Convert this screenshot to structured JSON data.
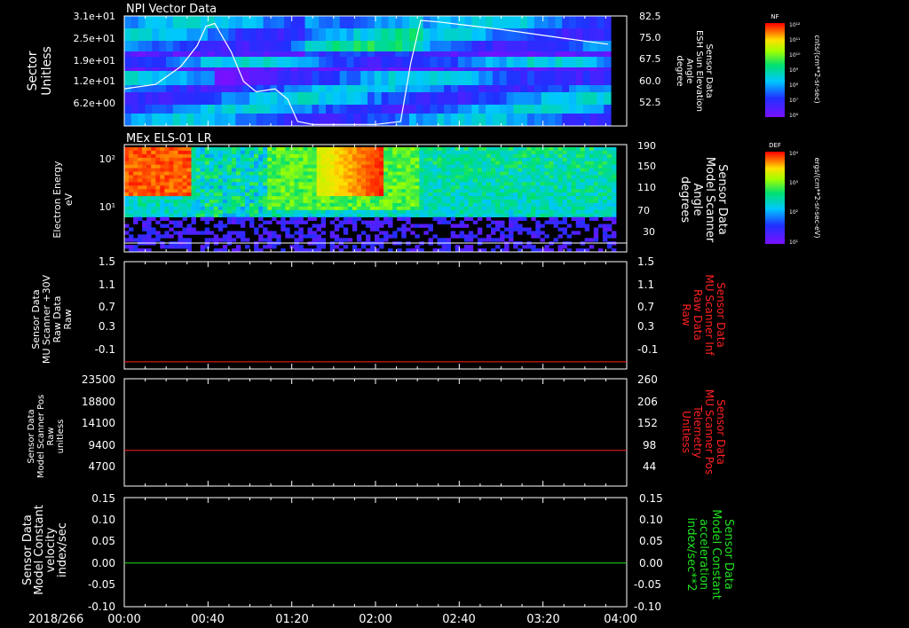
{
  "date_label": "2018/266",
  "x_ticks": [
    "00:00",
    "00:40",
    "01:20",
    "02:00",
    "02:40",
    "03:20",
    "04:00"
  ],
  "panels": [
    {
      "title": "NPI Vector Data",
      "left_label": [
        "Sector",
        "Unitless"
      ],
      "left_ticks": [
        "3.1e+01",
        "2.5e+01",
        "1.9e+01",
        "1.2e+01",
        "6.2e+00"
      ],
      "right_label": [
        "Sensor Data",
        "ESH Sun Elevation",
        "Angle",
        "degree"
      ],
      "right_ticks": [
        "82.5",
        "75.0",
        "67.5",
        "60.0",
        "52.5"
      ],
      "right_label_color": "#ffffff",
      "colorbar": {
        "label": "NF",
        "unit": "cnts/(cm**2-sr-sec)",
        "ticks": [
          "10¹²",
          "10¹¹",
          "10¹⁰",
          "10⁹",
          "10⁸",
          "10⁷",
          "10⁶"
        ]
      }
    },
    {
      "title": "MEx ELS-01 LR",
      "left_label": [
        "Electron Energy",
        "eV"
      ],
      "left_ticks": [
        "10²",
        "10¹"
      ],
      "right_label": [
        "Sensor Data",
        "Model Scanner",
        "Angle",
        "degrees"
      ],
      "right_ticks": [
        "190",
        "150",
        "110",
        "70",
        "30"
      ],
      "right_label_color": "#ffffff",
      "colorbar": {
        "label": "DEF",
        "unit": "ergs/(cm**2-sr-sec-eV)",
        "ticks": [
          "10⁴",
          "10³",
          "10²",
          "10¹"
        ]
      }
    },
    {
      "title": "",
      "left_label": [
        "Sensor Data",
        "MU Scanner +30V",
        "Raw Data",
        "Raw"
      ],
      "left_ticks": [
        "1.5",
        "1.1",
        "0.7",
        "0.3",
        "-0.1"
      ],
      "right_label": [
        "Sensor Data",
        "MU Scanner Inf",
        "Raw Data",
        "Raw"
      ],
      "right_ticks": [
        "1.5",
        "1.1",
        "0.7",
        "0.3",
        "-0.1"
      ],
      "right_label_color": "#ff2020"
    },
    {
      "title": "",
      "left_label": [
        "Sensor Data",
        "Model Scanner Pos",
        "Raw",
        "unitless"
      ],
      "left_ticks": [
        "23500",
        "18800",
        "14100",
        "9400",
        "4700"
      ],
      "right_label": [
        "Sensor Data",
        "MU Scanner Pos",
        "Telemetry",
        "Unitless"
      ],
      "right_ticks": [
        "260",
        "206",
        "152",
        "98",
        "44"
      ],
      "right_label_color": "#ff2020"
    },
    {
      "title": "",
      "left_label": [
        "Sensor Data",
        "Model Constant",
        "velocity",
        "index/sec"
      ],
      "left_ticks": [
        "0.15",
        "0.10",
        "0.05",
        "0.00",
        "-0.05",
        "-0.10"
      ],
      "right_label": [
        "Sensor Data",
        "Model Constant",
        "acceleration",
        "index/sec**2"
      ],
      "right_ticks": [
        "0.15",
        "0.10",
        "0.05",
        "0.00",
        "-0.05",
        "-0.10"
      ],
      "right_label_color": "#20e020"
    }
  ],
  "chart_data": [
    {
      "type": "heatmap",
      "title": "NPI Vector Data",
      "x_range": [
        "00:00",
        "04:00"
      ],
      "y_label": "Sector Unitless",
      "y_ticks": [
        31,
        25,
        19,
        12,
        6.2
      ],
      "overlay_line": {
        "name": "ESH Sun Elevation Angle",
        "color": "#ffffff",
        "ylim": [
          47,
          84
        ],
        "x_hours": [
          0,
          0.25,
          0.45,
          0.58,
          0.65,
          0.72,
          0.85,
          0.95,
          1.05,
          1.2,
          1.3,
          1.38,
          1.5,
          2.0,
          2.2,
          2.28,
          2.36,
          2.5,
          3.0,
          3.5,
          3.85
        ],
        "y": [
          59.5,
          61.0,
          67.0,
          74.0,
          80.5,
          81.5,
          72.0,
          62.0,
          58.5,
          59.5,
          56.0,
          48.5,
          47.5,
          47.5,
          48.5,
          68.0,
          82.5,
          82.0,
          79.5,
          76.5,
          74.5
        ]
      }
    },
    {
      "type": "heatmap",
      "title": "MEx ELS-01 LR",
      "x_range": [
        "00:00",
        "04:00"
      ],
      "y_label": "Electron Energy eV",
      "y_scale": "log",
      "y_ticks": [
        100,
        10
      ],
      "colorbar": "DEF"
    },
    {
      "type": "line",
      "x_range": [
        "00:00",
        "04:00"
      ],
      "ylim": [
        -0.3,
        1.5
      ],
      "series": [
        {
          "color": "#ff2020",
          "constant": -0.18
        }
      ]
    },
    {
      "type": "line",
      "x_range": [
        "00:00",
        "04:00"
      ],
      "ylim": [
        0,
        23500
      ],
      "series": [
        {
          "color": "#ff2020",
          "constant": 7800
        }
      ]
    },
    {
      "type": "line",
      "x_range": [
        "00:00",
        "04:00"
      ],
      "ylim": [
        -0.1,
        0.15
      ],
      "series": [
        {
          "color": "#20e020",
          "constant": 0.0
        }
      ]
    }
  ],
  "colors": {
    "background": "#000000",
    "axis": "#ffffff",
    "red_line": "#ff2020",
    "green_line": "#20e020"
  }
}
